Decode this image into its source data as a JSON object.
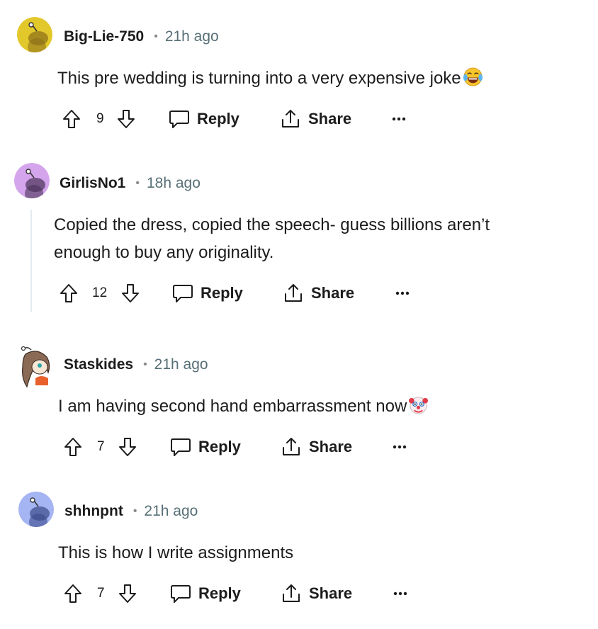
{
  "comments": [
    {
      "username": "Big-Lie-750",
      "time": "21h ago",
      "text": "This pre wedding is turning into a very expensive joke",
      "emoji": "laughing-emoji",
      "votes": "9",
      "reply": "Reply",
      "share": "Share",
      "avatar_color": "#e3c82b"
    },
    {
      "username": "GirlisNo1",
      "time": "18h ago",
      "text_line1": "Copied the dress, copied the speech- guess billions aren’t",
      "text_line2": "enough to buy any originality.",
      "votes": "12",
      "reply": "Reply",
      "share": "Share",
      "avatar_color": "#d4a5ec"
    },
    {
      "username": "Staskides",
      "time": "21h ago",
      "text": "I am having second hand embarrassment now",
      "emoji": "clown-emoji",
      "votes": "7",
      "reply": "Reply",
      "share": "Share",
      "avatar_color": "#ffffff"
    },
    {
      "username": "shhnpnt",
      "time": "21h ago",
      "text": "This is how I write assignments",
      "votes": "7",
      "reply": "Reply",
      "share": "Share",
      "avatar_color": "#a5b4f2"
    }
  ],
  "colors": {
    "text": "#1c1c1c",
    "meta": "#576f76",
    "thread_line": "#e5ebee"
  }
}
